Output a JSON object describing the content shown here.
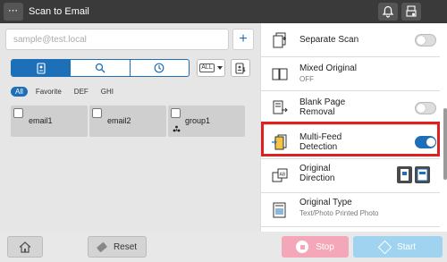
{
  "header": {
    "menu_label": "⋯",
    "title": "Scan to Email",
    "icons": [
      "bell-icon",
      "device-status-icon"
    ]
  },
  "address": {
    "placeholder": "sample@test.local",
    "value": ""
  },
  "search_tabs": [
    "address-book-icon",
    "search-icon",
    "history-icon"
  ],
  "dropdown": {
    "selected": "ALL"
  },
  "filters": [
    "All",
    "Favorite",
    "DEF",
    "GHI"
  ],
  "destinations": [
    {
      "name": "email1",
      "type": "email"
    },
    {
      "name": "email2",
      "type": "email"
    },
    {
      "name": "group1",
      "type": "group"
    }
  ],
  "settings": [
    {
      "title": "Separate Scan",
      "subtitle": "",
      "toggle": "off",
      "icon": "separate-scan-icon"
    },
    {
      "title": "Mixed Original",
      "subtitle": "OFF",
      "toggle": null,
      "icon": "mixed-original-icon"
    },
    {
      "title": "Blank Page\nRemoval",
      "subtitle": "",
      "toggle": "off",
      "icon": "blank-page-icon"
    },
    {
      "title": "Multi-Feed\nDetection",
      "subtitle": "",
      "toggle": "on",
      "icon": "multi-feed-icon"
    },
    {
      "title": "Original\nDirection",
      "subtitle": "",
      "toggle": null,
      "icon": "original-direction-icon"
    },
    {
      "title": "Original Type",
      "subtitle": "Text/Photo Printed Photo",
      "toggle": null,
      "icon": "original-type-icon"
    }
  ],
  "footer": {
    "reset_label": "Reset",
    "stop_label": "Stop",
    "start_label": "Start"
  },
  "colors": {
    "accent": "#1d6fb8",
    "highlight": "#e02020",
    "stop": "#f4a7b9",
    "start": "#9fd3ef"
  }
}
